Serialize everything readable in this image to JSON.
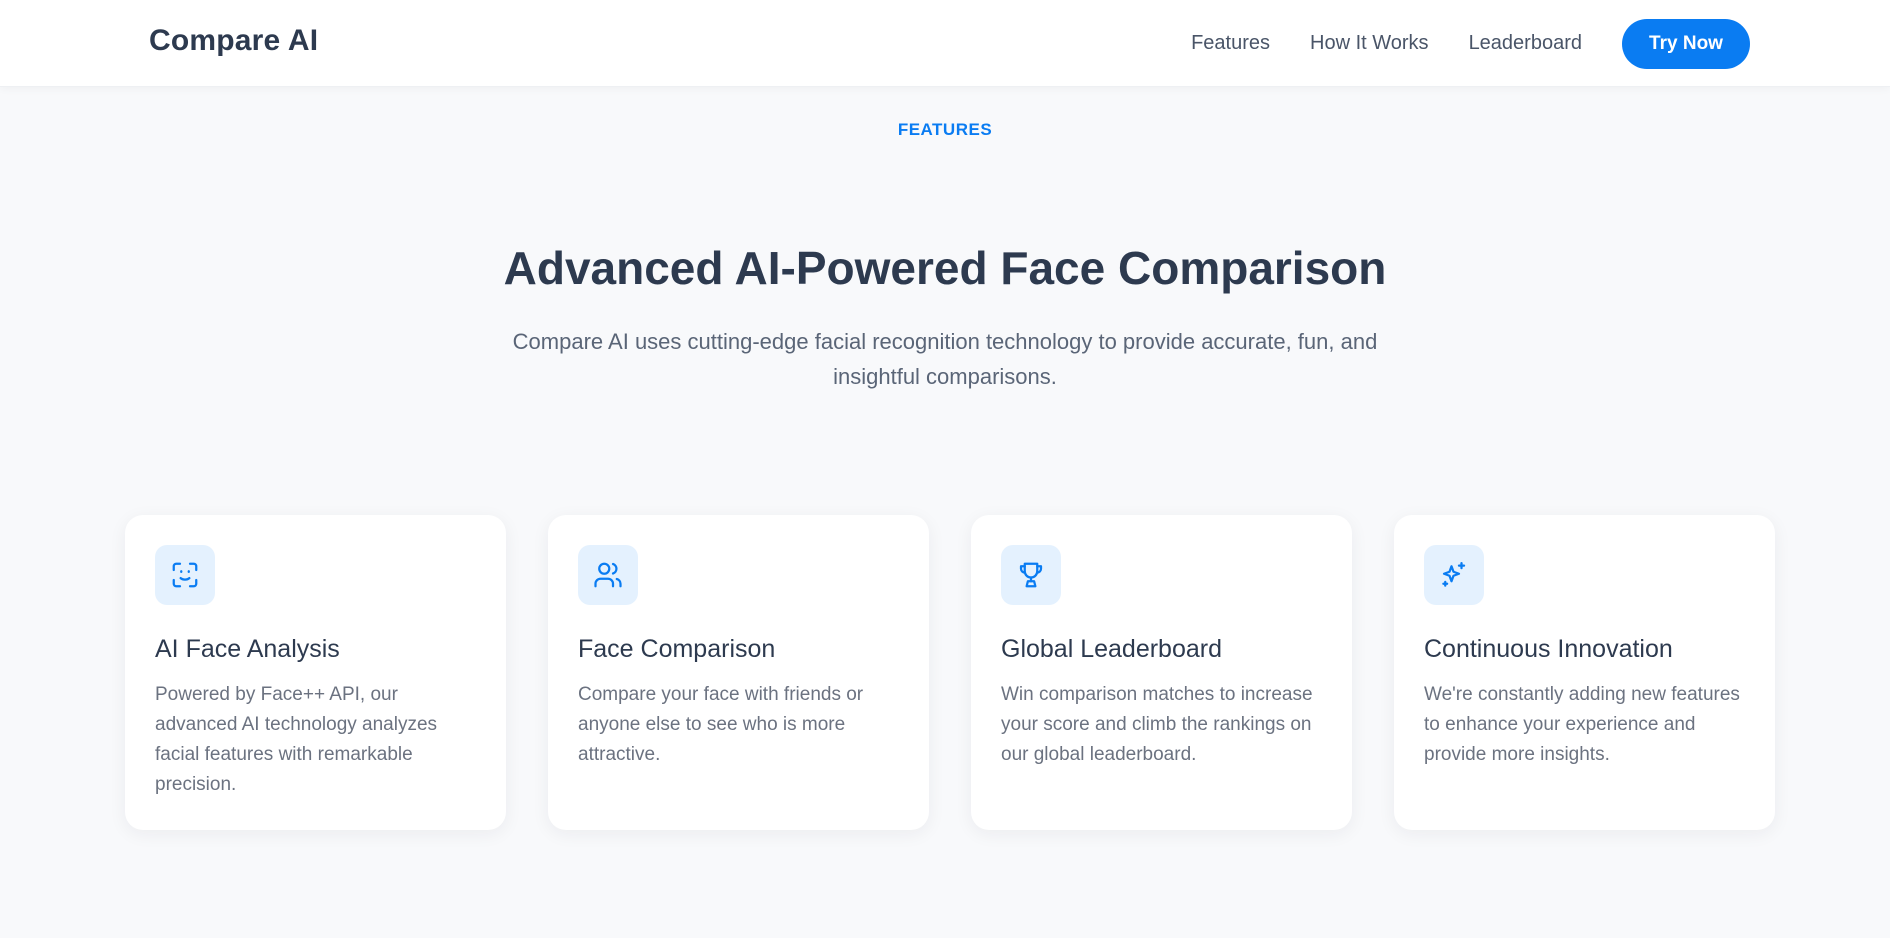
{
  "nav": {
    "logo": "Compare AI",
    "links": [
      "Features",
      "How It Works",
      "Leaderboard"
    ],
    "cta": "Try Now"
  },
  "hero": {
    "eyebrow": "FEATURES",
    "title": "Advanced AI-Powered Face Comparison",
    "subtitle": "Compare AI uses cutting-edge facial recognition technology to provide accurate, fun, and insightful comparisons."
  },
  "features": [
    {
      "icon": "face-scan-icon",
      "title": "AI Face Analysis",
      "description": "Powered by Face++ API, our advanced AI technology analyzes facial features with remarkable precision."
    },
    {
      "icon": "users-icon",
      "title": "Face Comparison",
      "description": "Compare your face with friends or anyone else to see who is more attractive."
    },
    {
      "icon": "trophy-icon",
      "title": "Global Leaderboard",
      "description": "Win comparison matches to increase your score and climb the rankings on our global leaderboard."
    },
    {
      "icon": "sparkles-icon",
      "title": "Continuous Innovation",
      "description": "We're constantly adding new features to enhance your experience and provide more insights."
    }
  ],
  "colors": {
    "accent": "#0a7cf2",
    "heading": "#2d3a4f",
    "body_text": "#6b7280",
    "background": "#f8f9fb",
    "icon_bg": "#e4f1fe"
  }
}
